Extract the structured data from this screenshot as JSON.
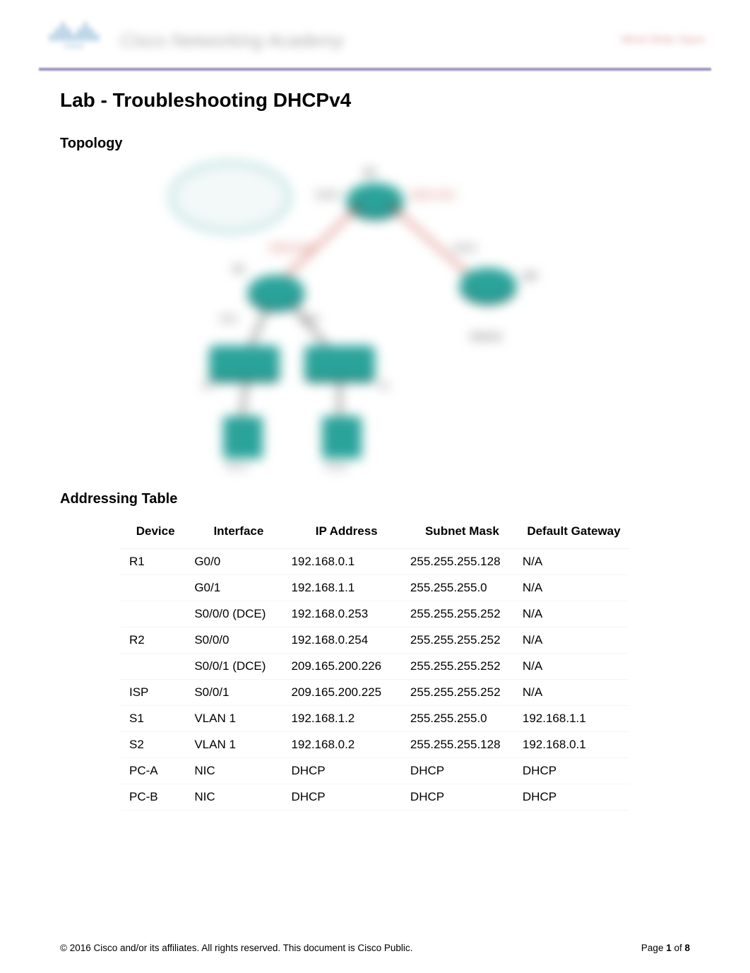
{
  "header": {
    "brand": "cisco",
    "academy_text": "Cisco Networking Academy",
    "right_text": "Mind Wide Open"
  },
  "title": "Lab - Troubleshooting DHCPv4",
  "sections": {
    "topology": "Topology",
    "addressing": "Addressing Table"
  },
  "topology_labels": {
    "r2": "R2",
    "r1": "R1",
    "isp": "ISP",
    "internet": "Internet",
    "s1": "S1",
    "s2": "S2",
    "pca": "PC-A",
    "pcb": "PC-B",
    "g00": "G0/0",
    "g01": "G0/1",
    "s000": "S0/0/0",
    "s001": "S0/0/1",
    "s000dce": "S0/0/0 DCE",
    "s001dce": "S0/0/1 DCE"
  },
  "table": {
    "headers": {
      "device": "Device",
      "interface": "Interface",
      "ip": "IP Address",
      "mask": "Subnet Mask",
      "gw": "Default Gateway"
    },
    "rows": [
      {
        "device": "R1",
        "iface": "G0/0",
        "ip": "192.168.0.1",
        "mask": "255.255.255.128",
        "gw": "N/A"
      },
      {
        "device": "",
        "iface": "G0/1",
        "ip": "192.168.1.1",
        "mask": "255.255.255.0",
        "gw": "N/A"
      },
      {
        "device": "",
        "iface": "S0/0/0 (DCE)",
        "ip": "192.168.0.253",
        "mask": "255.255.255.252",
        "gw": "N/A"
      },
      {
        "device": "R2",
        "iface": "S0/0/0",
        "ip": "192.168.0.254",
        "mask": "255.255.255.252",
        "gw": "N/A"
      },
      {
        "device": "",
        "iface": "S0/0/1 (DCE)",
        "ip": "209.165.200.226",
        "mask": "255.255.255.252",
        "gw": "N/A"
      },
      {
        "device": "ISP",
        "iface": "S0/0/1",
        "ip": "209.165.200.225",
        "mask": "255.255.255.252",
        "gw": "N/A"
      },
      {
        "device": "S1",
        "iface": "VLAN 1",
        "ip": "192.168.1.2",
        "mask": "255.255.255.0",
        "gw": "192.168.1.1"
      },
      {
        "device": "S2",
        "iface": "VLAN 1",
        "ip": "192.168.0.2",
        "mask": "255.255.255.128",
        "gw": "192.168.0.1"
      },
      {
        "device": "PC-A",
        "iface": "NIC",
        "ip": "DHCP",
        "mask": "DHCP",
        "gw": "DHCP"
      },
      {
        "device": "PC-B",
        "iface": "NIC",
        "ip": "DHCP",
        "mask": "DHCP",
        "gw": "DHCP"
      }
    ]
  },
  "footer": {
    "copyright": "© 2016 Cisco and/or its affiliates. All rights reserved. This document is Cisco Public.",
    "page_label_pre": "Page ",
    "page_current": "1",
    "page_label_mid": " of ",
    "page_total": "8"
  }
}
